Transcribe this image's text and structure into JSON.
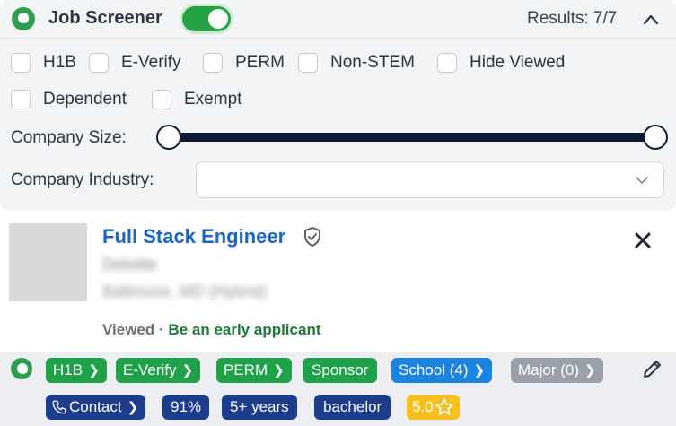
{
  "header": {
    "app_title": "Job Screener",
    "toggle_on": true,
    "results_label": "Results: 7/7",
    "collapse_icon": "chevron-up-icon"
  },
  "filters": {
    "checkboxes": [
      "H1B",
      "E-Verify",
      "PERM",
      "Non-STEM",
      "Hide Viewed",
      "Dependent",
      "Exempt"
    ],
    "company_size_label": "Company Size:",
    "company_industry_label": "Company Industry:",
    "industry_value": ""
  },
  "job": {
    "title": "Full Stack Engineer",
    "company": "Deloitte",
    "location": "Baltimore, MD (Hybrid)",
    "viewed": "Viewed",
    "separator": "·",
    "tagline": "Be an early applicant"
  },
  "tags": {
    "h1b": "H1B",
    "everify": "E-Verify",
    "perm": "PERM",
    "sponsor": "Sponsor",
    "school": "School (4)",
    "major": "Major (0)",
    "contact": "Contact",
    "match": "91%",
    "experience": "5+ years",
    "degree": "bachelor",
    "rating": "5.0"
  },
  "colors": {
    "brand_green": "#1fa14a",
    "link_blue": "#1a66c2",
    "navy": "#1c3c8c",
    "gold": "#f5bf1f"
  }
}
